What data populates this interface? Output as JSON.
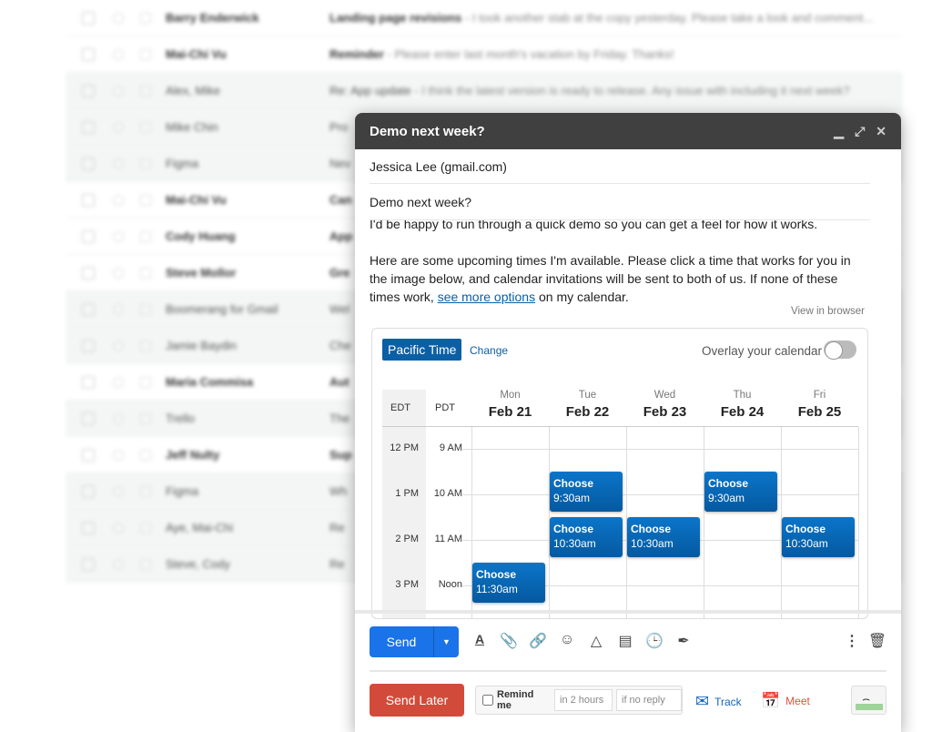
{
  "inbox": [
    {
      "sender": "Barry Enderwick",
      "subject": "Landing page revisions",
      "snippet": " - I took another stab at the copy yesterday. Please take a look and comment...",
      "unread": true
    },
    {
      "sender": "Mai-Chi Vu",
      "subject": "Reminder",
      "snippet": " - Please enter last month's vacation by Friday. Thanks!",
      "unread": true
    },
    {
      "sender": "Alex, Mike",
      "subject": "Re: App update",
      "snippet": " - I think the latest version is ready to release. Any issue with including it next week?",
      "unread": false
    },
    {
      "sender": "Mike Chin",
      "subject": "Pro",
      "snippet": "",
      "unread": false
    },
    {
      "sender": "Figma",
      "subject": "Nev",
      "snippet": "",
      "unread": false
    },
    {
      "sender": "Mai-Chi Vu",
      "subject": "Can",
      "snippet": "",
      "unread": true
    },
    {
      "sender": "Cody Huang",
      "subject": "App",
      "snippet": "",
      "unread": true
    },
    {
      "sender": "Steve Mollor",
      "subject": "Gre",
      "snippet": "",
      "unread": true
    },
    {
      "sender": "Boomerang for Gmail",
      "subject": "Wel",
      "snippet": "",
      "unread": false
    },
    {
      "sender": "Jamie Baydin",
      "subject": "Che",
      "snippet": "",
      "unread": false
    },
    {
      "sender": "Maria Commisa",
      "subject": "Aut",
      "snippet": "",
      "unread": true
    },
    {
      "sender": "Trello",
      "subject": "The",
      "snippet": "",
      "unread": false
    },
    {
      "sender": "Jeff Nulty",
      "subject": "Sup",
      "snippet": "",
      "unread": true
    },
    {
      "sender": "Figma",
      "subject": "Wh",
      "snippet": "",
      "unread": false
    },
    {
      "sender": "Aye, Mai-Chi",
      "subject": "Re",
      "snippet": "",
      "unread": false
    },
    {
      "sender": "Steve, Cody",
      "subject": "Re",
      "snippet": "",
      "unread": false
    }
  ],
  "compose": {
    "title": "Demo next week?",
    "to": "Jessica Lee  (gmail.com)",
    "subject": "Demo next week?",
    "body_line1": "I'd be happy to run through a quick demo so you can get a feel for how it works.",
    "body_p2_a": "Here are some upcoming times I'm available. Please click a time that works for you in the image below, and calendar invitations will be sent to both of us. If none of these times work, ",
    "body_link": "see more options",
    "body_p2_b": " on my calendar.",
    "view_in_browser": "View in browser"
  },
  "calendar": {
    "timezone": "Pacific Time",
    "change": "Change",
    "overlay": "Overlay your calendar",
    "overlay_on": false,
    "tz1": "EDT",
    "tz2": "PDT",
    "hours": [
      {
        "edt": "12 PM",
        "pdt": "9 AM"
      },
      {
        "edt": "1 PM",
        "pdt": "10 AM"
      },
      {
        "edt": "2 PM",
        "pdt": "11 AM"
      },
      {
        "edt": "3 PM",
        "pdt": "Noon"
      }
    ],
    "days": [
      {
        "name": "Mon",
        "date": "Feb 21"
      },
      {
        "name": "Tue",
        "date": "Feb 22"
      },
      {
        "name": "Wed",
        "date": "Feb 23"
      },
      {
        "name": "Thu",
        "date": "Feb 24"
      },
      {
        "name": "Fri",
        "date": "Feb 25"
      }
    ],
    "slots": [
      {
        "day": 1,
        "start_hour": 9.5,
        "label": "Choose",
        "time": "9:30am"
      },
      {
        "day": 3,
        "start_hour": 9.5,
        "label": "Choose",
        "time": "9:30am"
      },
      {
        "day": 1,
        "start_hour": 10.5,
        "label": "Choose",
        "time": "10:30am"
      },
      {
        "day": 2,
        "start_hour": 10.5,
        "label": "Choose",
        "time": "10:30am"
      },
      {
        "day": 4,
        "start_hour": 10.5,
        "label": "Choose",
        "time": "10:30am"
      },
      {
        "day": 0,
        "start_hour": 11.5,
        "label": "Choose",
        "time": "11:30am"
      }
    ],
    "slot_color": "#0b75c9"
  },
  "toolbar": {
    "send": "Send",
    "send_later": "Send Later",
    "remind_me": "Remind me",
    "remind_when": "in 2 hours",
    "remind_cond": "if no reply",
    "track": "Track",
    "meet": "Meet"
  },
  "colors": {
    "send": "#1a73e8",
    "send_later": "#d24b3a",
    "header": "#404040",
    "accent": "#0b5fa5"
  }
}
